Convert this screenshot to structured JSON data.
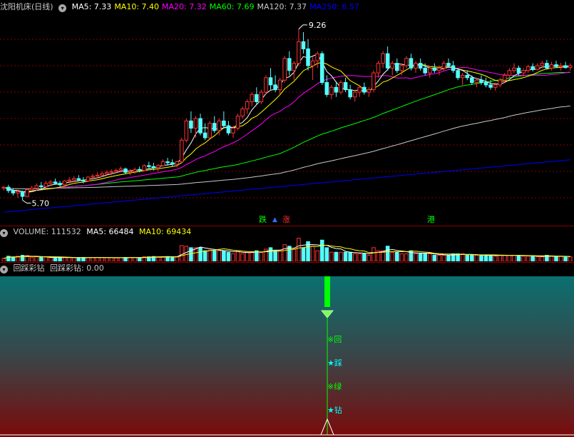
{
  "main": {
    "title": "沈阳机床(日线)",
    "ma_labels": [
      {
        "text": "MA5: 7.33",
        "color": "#ffffff"
      },
      {
        "text": "MA10: 7.40",
        "color": "#ffff00"
      },
      {
        "text": "MA20: 7.32",
        "color": "#ff00ff"
      },
      {
        "text": "MA60: 7.69",
        "color": "#00ff00"
      },
      {
        "text": "MA120: 7.37",
        "color": "#c8c8c8"
      },
      {
        "text": "MA250: 6.57",
        "color": "#0000ff"
      }
    ],
    "high_label": "9.26",
    "low_label": "5.70",
    "tags": [
      {
        "text": "跌",
        "color": "#00ff00"
      },
      {
        "text": "涨",
        "color": "#ff3030"
      },
      {
        "text": "港",
        "color": "#00ff00"
      }
    ]
  },
  "volume": {
    "label": "VOLUME: 111532",
    "ma5": "MA5: 66484",
    "ma10": "MA10: 69434"
  },
  "indicator": {
    "title": "回踩彩钻",
    "value_label": "回踩彩钻: 0.00",
    "signal_chars": [
      "※回",
      "★踩",
      "※绿",
      "★钻"
    ]
  },
  "colors": {
    "up": "#ff3232",
    "down": "#54ffff",
    "grid": "#8a0000",
    "ma5": "#ffffff",
    "ma10": "#ffff00",
    "ma20": "#ff00ff",
    "ma60": "#00ff00",
    "ma120": "#c8c8c8",
    "ma250": "#0000ff"
  },
  "chart_data": {
    "type": "candlestick",
    "series_note": "daily OHLC estimated from image",
    "ohlc": [
      [
        5.95,
        6.0,
        5.9,
        5.97
      ],
      [
        5.97,
        6.02,
        5.85,
        5.9
      ],
      [
        5.9,
        5.95,
        5.8,
        5.85
      ],
      [
        5.85,
        5.92,
        5.75,
        5.88
      ],
      [
        5.88,
        5.9,
        5.7,
        5.78
      ],
      [
        5.78,
        5.95,
        5.76,
        5.92
      ],
      [
        5.92,
        6.0,
        5.88,
        5.95
      ],
      [
        5.95,
        6.05,
        5.9,
        6.0
      ],
      [
        6.0,
        6.08,
        5.95,
        5.98
      ],
      [
        5.98,
        6.1,
        5.96,
        6.05
      ],
      [
        6.05,
        6.12,
        6.0,
        6.08
      ],
      [
        6.08,
        6.15,
        6.02,
        6.05
      ],
      [
        6.05,
        6.1,
        5.98,
        6.02
      ],
      [
        6.02,
        6.12,
        6.0,
        6.1
      ],
      [
        6.1,
        6.18,
        6.05,
        6.12
      ],
      [
        6.12,
        6.2,
        6.08,
        6.15
      ],
      [
        6.15,
        6.22,
        6.1,
        6.12
      ],
      [
        6.12,
        6.18,
        6.05,
        6.1
      ],
      [
        6.1,
        6.2,
        6.08,
        6.18
      ],
      [
        6.18,
        6.25,
        6.12,
        6.2
      ],
      [
        6.2,
        6.28,
        6.15,
        6.22
      ],
      [
        6.22,
        6.3,
        6.18,
        6.25
      ],
      [
        6.25,
        6.32,
        6.2,
        6.28
      ],
      [
        6.28,
        6.34,
        6.22,
        6.3
      ],
      [
        6.3,
        6.36,
        6.25,
        6.32
      ],
      [
        6.32,
        6.4,
        6.28,
        6.35
      ],
      [
        6.35,
        6.38,
        6.25,
        6.28
      ],
      [
        6.28,
        6.35,
        6.22,
        6.3
      ],
      [
        6.3,
        6.38,
        6.25,
        6.34
      ],
      [
        6.34,
        6.4,
        6.28,
        6.32
      ],
      [
        6.32,
        6.45,
        6.3,
        6.42
      ],
      [
        6.42,
        6.5,
        6.35,
        6.4
      ],
      [
        6.4,
        6.48,
        6.32,
        6.38
      ],
      [
        6.38,
        6.45,
        6.3,
        6.42
      ],
      [
        6.42,
        6.55,
        6.4,
        6.5
      ],
      [
        6.5,
        6.58,
        6.42,
        6.48
      ],
      [
        6.48,
        6.55,
        6.4,
        6.45
      ],
      [
        6.45,
        6.52,
        6.38,
        6.5
      ],
      [
        6.5,
        7.0,
        6.48,
        6.95
      ],
      [
        6.95,
        7.4,
        6.9,
        7.35
      ],
      [
        7.35,
        7.55,
        7.1,
        7.2
      ],
      [
        7.2,
        7.45,
        7.0,
        7.4
      ],
      [
        7.4,
        7.5,
        7.05,
        7.1
      ],
      [
        7.1,
        7.3,
        6.95,
        7.0
      ],
      [
        7.0,
        7.35,
        6.98,
        7.3
      ],
      [
        7.3,
        7.45,
        7.1,
        7.15
      ],
      [
        7.15,
        7.4,
        7.05,
        7.35
      ],
      [
        7.35,
        7.55,
        7.2,
        7.25
      ],
      [
        7.25,
        7.35,
        7.05,
        7.1
      ],
      [
        7.1,
        7.25,
        7.0,
        7.2
      ],
      [
        7.2,
        7.5,
        7.15,
        7.45
      ],
      [
        7.45,
        7.65,
        7.4,
        7.6
      ],
      [
        7.6,
        7.8,
        7.5,
        7.75
      ],
      [
        7.75,
        7.95,
        7.65,
        7.9
      ],
      [
        7.9,
        8.05,
        7.7,
        7.75
      ],
      [
        7.75,
        8.0,
        7.7,
        7.95
      ],
      [
        7.95,
        8.3,
        7.9,
        8.25
      ],
      [
        8.25,
        8.45,
        8.0,
        8.1
      ],
      [
        8.1,
        8.3,
        7.95,
        8.0
      ],
      [
        8.0,
        8.25,
        7.9,
        8.2
      ],
      [
        8.2,
        8.7,
        8.15,
        8.65
      ],
      [
        8.65,
        8.8,
        8.3,
        8.4
      ],
      [
        8.4,
        8.6,
        8.2,
        8.55
      ],
      [
        8.55,
        9.26,
        8.5,
        9.0
      ],
      [
        9.0,
        9.2,
        8.75,
        8.85
      ],
      [
        8.85,
        9.05,
        8.4,
        8.5
      ],
      [
        8.5,
        8.7,
        8.2,
        8.6
      ],
      [
        8.6,
        8.8,
        8.45,
        8.75
      ],
      [
        8.75,
        8.8,
        8.1,
        8.15
      ],
      [
        8.15,
        8.3,
        7.85,
        7.9
      ],
      [
        7.9,
        8.1,
        7.8,
        8.05
      ],
      [
        8.05,
        8.15,
        7.85,
        7.95
      ],
      [
        7.95,
        8.2,
        7.9,
        8.15
      ],
      [
        8.15,
        8.25,
        7.95,
        8.0
      ],
      [
        8.0,
        8.1,
        7.8,
        7.85
      ],
      [
        7.85,
        8.0,
        7.75,
        7.95
      ],
      [
        7.95,
        8.1,
        7.85,
        8.05
      ],
      [
        8.05,
        8.15,
        7.9,
        7.95
      ],
      [
        7.95,
        8.05,
        7.85,
        8.0
      ],
      [
        8.0,
        8.4,
        7.95,
        8.35
      ],
      [
        8.35,
        8.6,
        8.25,
        8.55
      ],
      [
        8.55,
        8.8,
        8.45,
        8.75
      ],
      [
        8.75,
        8.9,
        8.4,
        8.45
      ],
      [
        8.45,
        8.6,
        8.3,
        8.55
      ],
      [
        8.55,
        8.65,
        8.35,
        8.4
      ],
      [
        8.4,
        8.55,
        8.3,
        8.5
      ],
      [
        8.5,
        8.7,
        8.45,
        8.65
      ],
      [
        8.65,
        8.75,
        8.4,
        8.45
      ],
      [
        8.45,
        8.6,
        8.35,
        8.55
      ],
      [
        8.55,
        8.65,
        8.4,
        8.45
      ],
      [
        8.45,
        8.55,
        8.3,
        8.35
      ],
      [
        8.35,
        8.5,
        8.25,
        8.45
      ],
      [
        8.45,
        8.55,
        8.35,
        8.4
      ],
      [
        8.4,
        8.5,
        8.3,
        8.45
      ],
      [
        8.45,
        8.6,
        8.4,
        8.55
      ],
      [
        8.55,
        8.65,
        8.45,
        8.5
      ],
      [
        8.5,
        8.6,
        8.35,
        8.4
      ],
      [
        8.4,
        8.45,
        8.2,
        8.25
      ],
      [
        8.25,
        8.35,
        8.1,
        8.3
      ],
      [
        8.3,
        8.4,
        8.2,
        8.25
      ],
      [
        8.25,
        8.3,
        8.1,
        8.15
      ],
      [
        8.15,
        8.25,
        8.05,
        8.2
      ],
      [
        8.2,
        8.3,
        8.1,
        8.15
      ],
      [
        8.15,
        8.25,
        8.05,
        8.1
      ],
      [
        8.1,
        8.2,
        8.0,
        8.05
      ],
      [
        8.05,
        8.15,
        7.98,
        8.1
      ],
      [
        8.1,
        8.25,
        8.05,
        8.2
      ],
      [
        8.2,
        8.35,
        8.15,
        8.3
      ],
      [
        8.3,
        8.45,
        8.25,
        8.4
      ],
      [
        8.4,
        8.55,
        8.35,
        8.45
      ],
      [
        8.45,
        8.5,
        8.3,
        8.35
      ],
      [
        8.35,
        8.45,
        8.28,
        8.4
      ],
      [
        8.4,
        8.52,
        8.35,
        8.48
      ],
      [
        8.48,
        8.55,
        8.38,
        8.42
      ],
      [
        8.42,
        8.55,
        8.4,
        8.5
      ],
      [
        8.5,
        8.6,
        8.45,
        8.55
      ],
      [
        8.55,
        8.62,
        8.42,
        8.45
      ],
      [
        8.45,
        8.58,
        8.4,
        8.52
      ],
      [
        8.52,
        8.6,
        8.45,
        8.48
      ],
      [
        8.48,
        8.56,
        8.4,
        8.5
      ],
      [
        8.5,
        8.58,
        8.44,
        8.46
      ],
      [
        8.46,
        8.55,
        8.4,
        8.5
      ]
    ],
    "price_range": [
      5.2,
      9.6
    ],
    "volume_range": [
      0,
      250000
    ],
    "ma_lines": [
      "MA5",
      "MA10",
      "MA20",
      "MA60",
      "MA120",
      "MA250"
    ]
  }
}
